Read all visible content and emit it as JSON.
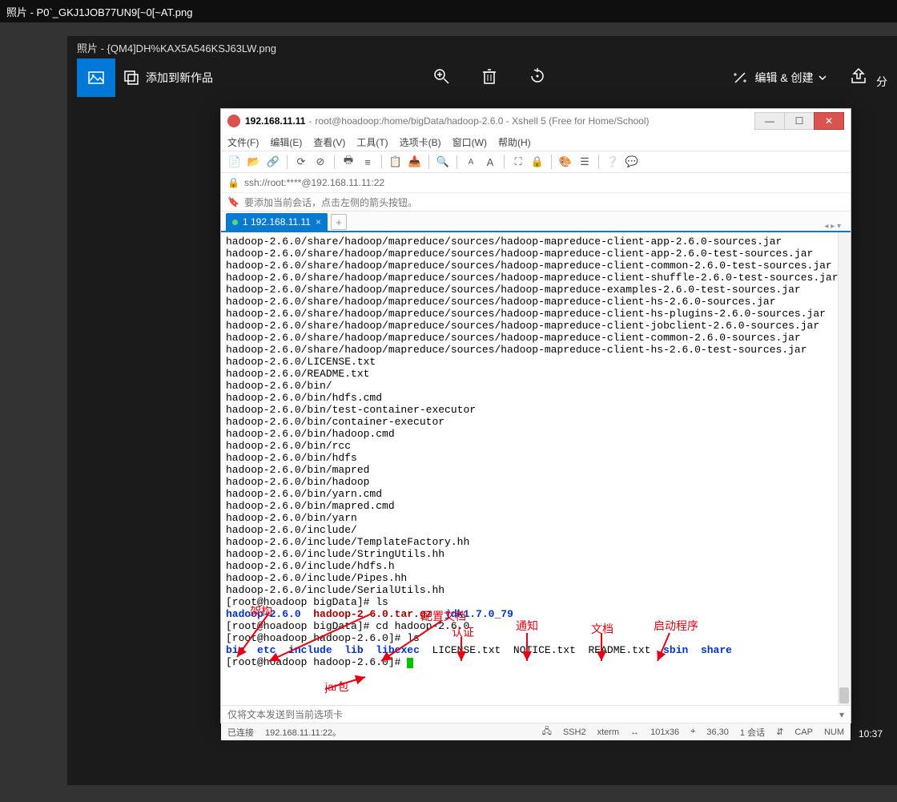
{
  "outer": {
    "title": "照片 - P0`_GKJ1JOB77UN9[~0[~AT.png"
  },
  "inner": {
    "title": "照片 - {QM4]DH%KAX5A546KSJ63LW.png",
    "addTo": "添加到新作品",
    "editCreate": "编辑 & 创建"
  },
  "xshell": {
    "ip": "192.168.11.11",
    "titleRest": "root@hoadoop:/home/bigData/hadoop-2.6.0 - Xshell 5 (Free for Home/School)",
    "menus": [
      "文件(F)",
      "编辑(E)",
      "查看(V)",
      "工具(T)",
      "选项卡(B)",
      "窗口(W)",
      "帮助(H)"
    ],
    "addr": "ssh://root:****@192.168.11.11:22",
    "hint": "要添加当前会话，点击左侧的箭头按钮。",
    "tab": "1 192.168.11.11",
    "term": {
      "lines": [
        "hadoop-2.6.0/share/hadoop/mapreduce/sources/hadoop-mapreduce-client-app-2.6.0-sources.jar",
        "hadoop-2.6.0/share/hadoop/mapreduce/sources/hadoop-mapreduce-client-app-2.6.0-test-sources.jar",
        "hadoop-2.6.0/share/hadoop/mapreduce/sources/hadoop-mapreduce-client-common-2.6.0-test-sources.jar",
        "hadoop-2.6.0/share/hadoop/mapreduce/sources/hadoop-mapreduce-client-shuffle-2.6.0-test-sources.jar",
        "hadoop-2.6.0/share/hadoop/mapreduce/sources/hadoop-mapreduce-examples-2.6.0-test-sources.jar",
        "hadoop-2.6.0/share/hadoop/mapreduce/sources/hadoop-mapreduce-client-hs-2.6.0-sources.jar",
        "hadoop-2.6.0/share/hadoop/mapreduce/sources/hadoop-mapreduce-client-hs-plugins-2.6.0-sources.jar",
        "hadoop-2.6.0/share/hadoop/mapreduce/sources/hadoop-mapreduce-client-jobclient-2.6.0-sources.jar",
        "hadoop-2.6.0/share/hadoop/mapreduce/sources/hadoop-mapreduce-client-common-2.6.0-sources.jar",
        "hadoop-2.6.0/share/hadoop/mapreduce/sources/hadoop-mapreduce-client-hs-2.6.0-test-sources.jar",
        "hadoop-2.6.0/LICENSE.txt",
        "hadoop-2.6.0/README.txt",
        "hadoop-2.6.0/bin/",
        "hadoop-2.6.0/bin/hdfs.cmd",
        "hadoop-2.6.0/bin/test-container-executor",
        "hadoop-2.6.0/bin/container-executor",
        "hadoop-2.6.0/bin/hadoop.cmd",
        "hadoop-2.6.0/bin/rcc",
        "hadoop-2.6.0/bin/hdfs",
        "hadoop-2.6.0/bin/mapred",
        "hadoop-2.6.0/bin/hadoop",
        "hadoop-2.6.0/bin/yarn.cmd",
        "hadoop-2.6.0/bin/mapred.cmd",
        "hadoop-2.6.0/bin/yarn",
        "hadoop-2.6.0/include/",
        "hadoop-2.6.0/include/TemplateFactory.hh",
        "hadoop-2.6.0/include/StringUtils.hh",
        "hadoop-2.6.0/include/hdfs.h",
        "hadoop-2.6.0/include/Pipes.hh",
        "hadoop-2.6.0/include/SerialUtils.hh"
      ],
      "prompt1": "[root@hoadoop bigData]# ls",
      "ls1": {
        "hadoop": "hadoop-2.6.0",
        "tar": "hadoop-2.6.0.tar.gz",
        "jdk": "jdk1.7.0_79"
      },
      "prompt2": "[root@hoadoop bigData]# cd hadoop-2.6.0",
      "prompt3": "[root@hoadoop hadoop-2.6.0]# ls",
      "ls2": {
        "bin": "bin",
        "etc": "etc",
        "include": "include",
        "lib": "lib",
        "libexec": "libexec",
        "license": "LICENSE.txt",
        "notice": "NOTICE.txt",
        "readme": "README.txt",
        "sbin": "sbin",
        "share": "share"
      },
      "prompt4": "[root@hoadoop hadoop-2.6.0]# "
    },
    "send": "仅将文本发送到当前选项卡",
    "status": {
      "conn": "已连接",
      "host": "192.168.11.11:22。",
      "ssh": "SSH2",
      "term": "xterm",
      "size": "101x36",
      "pos": "36,30",
      "sess": "1 会话",
      "cap": "CAP",
      "num": "NUM"
    }
  },
  "ann": {
    "conf": "配置文档",
    "auth": "认证",
    "notice": "通知",
    "doc": "文档",
    "boot": "启动程序",
    "jar": "jar包",
    "arch": "架构"
  },
  "clock": "10:37"
}
